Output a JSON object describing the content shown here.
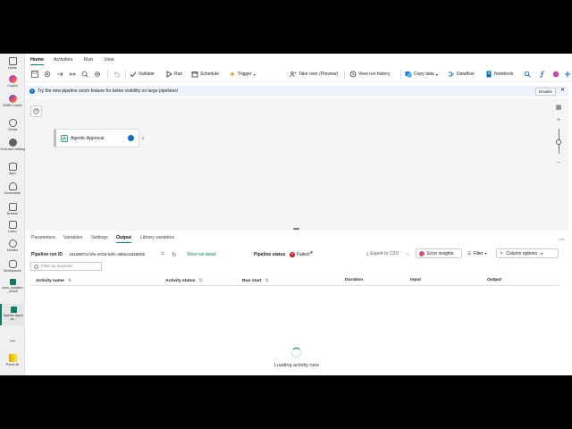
{
  "rail": {
    "items": [
      {
        "label": "Home",
        "icon": "home-icon",
        "color": "#616161"
      },
      {
        "label": "Copilot",
        "icon": "copilot-icon",
        "color": "#7b61ff"
      },
      {
        "label": "M365 Copilot",
        "icon": "m365-copilot-icon",
        "color": "#e0457b"
      },
      {
        "label": "Create",
        "icon": "create-icon",
        "color": "#616161"
      },
      {
        "label": "OneLake catalog",
        "icon": "onelake-icon",
        "color": "#616161"
      },
      {
        "label": "Apps",
        "icon": "apps-icon",
        "color": "#616161"
      },
      {
        "label": "Scorecards",
        "icon": "scorecards-icon",
        "color": "#616161"
      },
      {
        "label": "Browse",
        "icon": "browse-icon",
        "color": "#616161"
      },
      {
        "label": "Learn",
        "icon": "learn-icon",
        "color": "#616161"
      },
      {
        "label": "Monitor",
        "icon": "monitor-icon",
        "color": "#616161"
      },
      {
        "label": "Workspaces",
        "icon": "workspaces-icon",
        "color": "#616161"
      },
      {
        "label": "zava_analytics_online",
        "icon": "workspace-icon",
        "color": "#117865"
      },
      {
        "label": "Agentic Approva...",
        "icon": "pipeline-icon",
        "color": "#117865"
      },
      {
        "label": "...",
        "icon": "more-icon",
        "color": "#616161"
      },
      {
        "label": "Power BI",
        "icon": "powerbi-icon",
        "color": "#f2c811"
      }
    ]
  },
  "menu": {
    "tabs": [
      "Home",
      "Activities",
      "Run",
      "View"
    ]
  },
  "toolbar": {
    "validate": "Validate",
    "run": "Run",
    "schedule": "Schedule",
    "trigger": "Trigger",
    "take_over": "Take over (Preview)",
    "view_run_history": "View run history",
    "copy_data": "Copy data",
    "dataflow": "Dataflow",
    "notebook": "Notebook"
  },
  "banner": {
    "text": "Try the new pipeline zoom feature for better visibility on large pipelines!",
    "disable": "Disable"
  },
  "canvas": {
    "activity_name": "Agentic Approval",
    "zoom_in": "+",
    "zoom_out": "−"
  },
  "panel": {
    "tabs": [
      "Parameters",
      "Variables",
      "Settings",
      "Output",
      "Library variables"
    ],
    "active_tab": "Output",
    "run_id_label": "Pipeline run ID",
    "run_id": "1615897a-f4fe-4035-b0fc-48b6c5d2805b",
    "view_run_detail": "View run detail",
    "status_label": "Pipeline status",
    "status": "Failed",
    "export_csv": "Export to CSV",
    "error_insights": "Error insights",
    "filter": "Filter",
    "column_options": "Column options",
    "filter_placeholder": "Filter by keyword",
    "columns": [
      "Activity name",
      "Activity status",
      "Run start",
      "Duration",
      "Input",
      "Output"
    ],
    "loading": "Loading activity runs"
  },
  "colors": {
    "accent": "#117865",
    "failed": "#c50f1f",
    "info": "#0f6cbd"
  }
}
